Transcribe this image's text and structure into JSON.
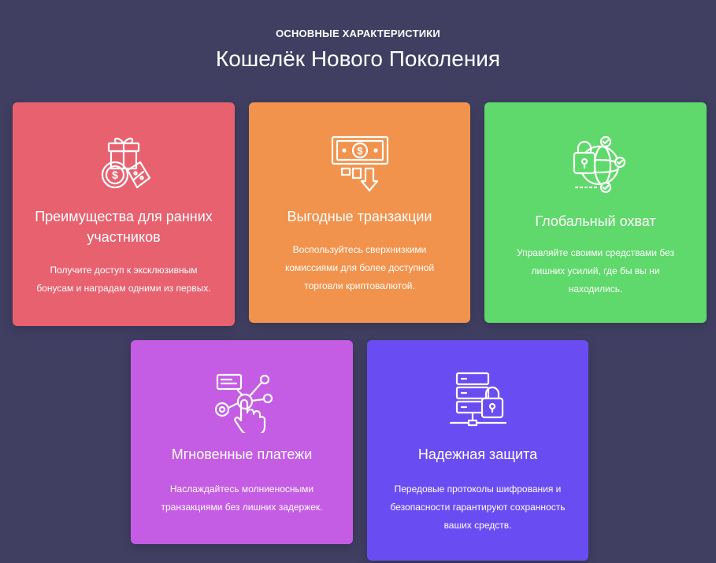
{
  "header": {
    "eyebrow": "ОСНОВНЫЕ ХАРАКТЕРИСТИКИ",
    "title": "Кошелёк Нового Поколения"
  },
  "features": [
    {
      "icon": "gift-coin-discount-icon",
      "color": "#e8616f",
      "title": "Преимущества для ранних участников",
      "text": "Получите доступ к эксклюзивным бонусам и наградам одними из первых."
    },
    {
      "icon": "dollar-bill-transfer-icon",
      "color": "#f2934d",
      "title": "Выгодные транзакции",
      "text": "Воспользуйтесь сверхнизкими комиссиями для более доступной торговли криптовалютой."
    },
    {
      "icon": "lock-globe-icon",
      "color": "#5fd96b",
      "title": "Глобальный охват",
      "text": "Управляйте своими средствами без лишних усилий, где бы вы ни находились."
    },
    {
      "icon": "touch-network-icon",
      "color": "#c55ce4",
      "title": "Мгновенные платежи",
      "text": "Наслаждайтесь молниеносными транзакциями без лишних задержек."
    },
    {
      "icon": "server-lock-icon",
      "color": "#6a4df2",
      "title": "Надежная защита",
      "text": "Передовые протоколы шифрования и безопасности гарантируют сохранность ваших средств."
    }
  ]
}
